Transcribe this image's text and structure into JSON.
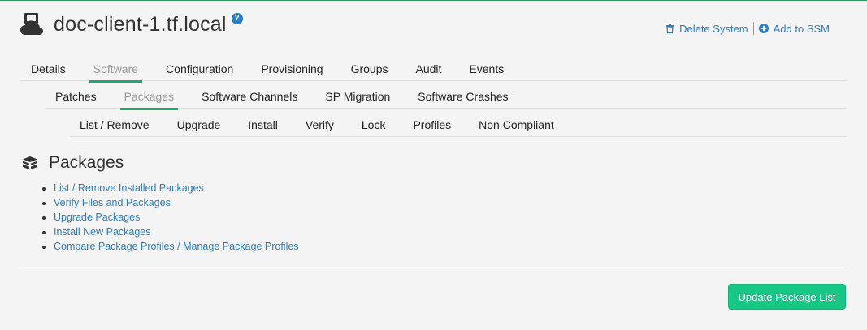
{
  "header": {
    "system_name": "doc-client-1.tf.local",
    "help_glyph": "?",
    "icon": "cloud-server-icon"
  },
  "actions": {
    "delete_system": "Delete System",
    "add_to_ssm": "Add to SSM"
  },
  "tabs_level1": [
    "Details",
    "Software",
    "Configuration",
    "Provisioning",
    "Groups",
    "Audit",
    "Events"
  ],
  "tabs_level1_active": "Software",
  "tabs_level2": [
    "Patches",
    "Packages",
    "Software Channels",
    "SP Migration",
    "Software Crashes"
  ],
  "tabs_level2_active": "Packages",
  "tabs_level3": [
    "List / Remove",
    "Upgrade",
    "Install",
    "Verify",
    "Lock",
    "Profiles",
    "Non Compliant"
  ],
  "section": {
    "title": "Packages",
    "icon": "boxes-icon",
    "links": [
      "List / Remove Installed Packages",
      "Verify Files and Packages",
      "Upgrade Packages",
      "Install New Packages",
      "Compare Package Profiles / Manage Package Profiles"
    ]
  },
  "update_button": "Update Package List",
  "colors": {
    "accent": "#1fa870",
    "link": "#2a7ec4",
    "button": "#16c786",
    "background": "#f4f4f4"
  }
}
